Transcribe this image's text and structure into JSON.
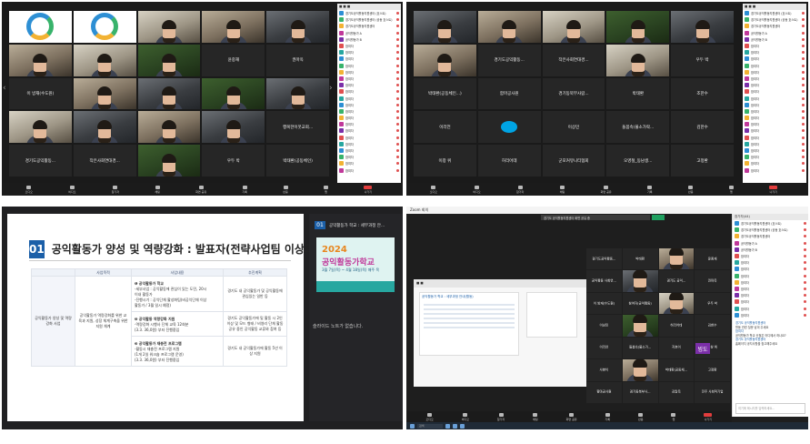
{
  "q1": {
    "tiles": [
      {
        "kind": "logo",
        "name": ""
      },
      {
        "kind": "logo",
        "name": ""
      },
      {
        "kind": "cam",
        "style": "office",
        "name": ""
      },
      {
        "kind": "cam",
        "style": "warm",
        "name": ""
      },
      {
        "kind": "cam",
        "style": "",
        "name": ""
      },
      {
        "kind": "cam",
        "style": "warm",
        "name": ""
      },
      {
        "kind": "cam",
        "style": "office",
        "name": ""
      },
      {
        "kind": "cam",
        "style": "green",
        "name": ""
      },
      {
        "kind": "text",
        "name": "윤중재"
      },
      {
        "kind": "text",
        "name": "권마옥"
      },
      {
        "kind": "text",
        "name": "이 방재(수도원)"
      },
      {
        "kind": "cam",
        "style": "warm",
        "name": ""
      },
      {
        "kind": "cam",
        "style": "",
        "name": ""
      },
      {
        "kind": "cam",
        "style": "green",
        "name": ""
      },
      {
        "kind": "cam",
        "style": "",
        "name": ""
      },
      {
        "kind": "cam",
        "style": "office",
        "name": ""
      },
      {
        "kind": "cam",
        "style": "",
        "name": ""
      },
      {
        "kind": "cam",
        "style": "warm",
        "name": ""
      },
      {
        "kind": "cam",
        "style": "",
        "name": ""
      },
      {
        "kind": "text",
        "name": "행복한이웃교회..."
      },
      {
        "kind": "text",
        "name": "경기도공익활동..."
      },
      {
        "kind": "text",
        "name": "작은사회연대경..."
      },
      {
        "kind": "cam",
        "style": "green",
        "name": ""
      },
      {
        "kind": "text",
        "name": "우두 박"
      },
      {
        "kind": "text",
        "name": "박태환(공동체인)"
      }
    ],
    "participants": [
      "경기도공익활동지원센터 (호스트)",
      "경기도공익활동지원센터 (공동 호스트)",
      "경기도공익활동지원센터",
      "공익활동가 A",
      "공익활동가 B",
      "참여자",
      "참여자",
      "참여자",
      "참여자",
      "참여자",
      "참여자",
      "참여자",
      "참여자",
      "참여자",
      "참여자",
      "참여자",
      "참여자",
      "참여자",
      "참여자",
      "참여자",
      "참여자",
      "참여자",
      "참여자",
      "참여자",
      "참여자"
    ]
  },
  "q2": {
    "tiles": [
      {
        "kind": "cam",
        "style": "",
        "name": ""
      },
      {
        "kind": "cam",
        "style": "warm",
        "name": ""
      },
      {
        "kind": "cam",
        "style": "office",
        "name": ""
      },
      {
        "kind": "cam",
        "style": "green",
        "name": ""
      },
      {
        "kind": "cam",
        "style": "",
        "name": ""
      },
      {
        "kind": "cam",
        "style": "warm",
        "name": ""
      },
      {
        "kind": "text",
        "name": "경기도공익활동..."
      },
      {
        "kind": "text",
        "name": "작은사회연대경..."
      },
      {
        "kind": "cam",
        "style": "office",
        "name": ""
      },
      {
        "kind": "text",
        "name": "우두 박"
      },
      {
        "kind": "text",
        "name": "박태환(공동체인...)"
      },
      {
        "kind": "text",
        "name": "함마공사원"
      },
      {
        "kind": "text",
        "name": "경기동북부사람..."
      },
      {
        "kind": "text",
        "name": "박태환"
      },
      {
        "kind": "text",
        "name": "조한수"
      },
      {
        "kind": "text",
        "name": "이리언"
      },
      {
        "kind": "pill",
        "name": ""
      },
      {
        "kind": "text",
        "name": "이상민"
      },
      {
        "kind": "text",
        "name": "돌봄속(불소가락..."
      },
      {
        "kind": "text",
        "name": "김한수"
      },
      {
        "kind": "text",
        "name": "이창 위"
      },
      {
        "kind": "text",
        "name": "허리어데"
      },
      {
        "kind": "text",
        "name": "군포커뮤니티협회"
      },
      {
        "kind": "text",
        "name": "오영철_동남생..."
      },
      {
        "kind": "text",
        "name": "고정환"
      }
    ]
  },
  "q3": {
    "slide_number": "01",
    "slide_title": "공익활동가 양성 및 역량강화 : 발표자(전략사업팀 이상화 팀장)",
    "table_headers": [
      "",
      "사업목적",
      "사업내용",
      "추진계획"
    ],
    "category": "공익활동가 양성 및 역량강화 사업",
    "goal": "공익활동가 역량강화를 위한 교육과 지원, 성장 체계구축을 위한 지원 체계",
    "rows": [
      {
        "title": "❶ 공익활동가 학교",
        "lines": [
          "-세부사업 : 공익활동에 관심이 있는 도민, 20시",
          "이내 활동가",
          "-진행시기 : 공익단체 활성화팀(비공익단체 이상",
          "활동가 / 3월 일시 예정)"
        ],
        "note": "경기도 내 공익활동가 및 공익활동에 관심있는 일반 등"
      },
      {
        "title": "❷ 공익활동 역량강화 지원",
        "lines": [
          "-역량강화 시행사 단체 교육 12회분",
          "(3.3. 36,0원) 부터 진행중임"
        ],
        "note": "경기도 공익활동가에 및 활동 시 2인 이상 및 모드 형태 / 비영리 단체 활동 공유 중인 공익활동 교류와 참여 등"
      },
      {
        "title": "❸ 공익활동가 재충전 프로그램",
        "lines": [
          "-활동시 재충전 프로그램 지원",
          "(1개 2일 워크숍 프로그램 운영)",
          "(3.3. 36,0원) 부터 진행중임"
        ],
        "note": "경기도 내 공익활동가에 활동 5년 이상 지원"
      }
    ],
    "side_number": "01",
    "side_title": "공익활동가 학교 : 세부과정 안...",
    "poster_year": "2024",
    "poster_title": "공익활동가학교",
    "poster_dates": "3월 7일(목) ~ 4월 18일(목) 매주 목",
    "notice": "슬라이드 노트가 없습니다."
  },
  "q4": {
    "window_title": "Zoom 회의",
    "share_banner": "경기도 공익활동지원센터 화면 공유 중",
    "shared_header": "공익활동가 학교 : 세부과정 안내(활동)",
    "tiles": [
      {
        "kind": "text",
        "name": "경기도공익활동..."
      },
      {
        "kind": "text",
        "name": "박태환"
      },
      {
        "kind": "cam",
        "style": "warm",
        "name": ""
      },
      {
        "kind": "text",
        "name": "윤중재"
      },
      {
        "kind": "text",
        "name": "공익활동 사회연..."
      },
      {
        "kind": "cam",
        "style": "",
        "name": ""
      },
      {
        "kind": "text",
        "name": "경기도 공익..."
      },
      {
        "kind": "text",
        "name": "권마옥"
      },
      {
        "kind": "text",
        "name": "이 방재(수도원)"
      },
      {
        "kind": "text",
        "name": "참여자(공익활동)"
      },
      {
        "kind": "cam",
        "style": "office",
        "name": ""
      },
      {
        "kind": "text",
        "name": "우두 박"
      },
      {
        "kind": "text",
        "name": "이상민"
      },
      {
        "kind": "cam",
        "style": "green",
        "name": ""
      },
      {
        "kind": "text",
        "name": "허리어데"
      },
      {
        "kind": "text",
        "name": "김한수"
      },
      {
        "kind": "text",
        "name": "이리언"
      },
      {
        "kind": "text",
        "name": "돌봄속(불소가..."
      },
      {
        "kind": "text",
        "name": "지호이"
      },
      {
        "kind": "text",
        "name": "이창 위"
      },
      {
        "kind": "text",
        "name": "사향이"
      },
      {
        "kind": "cam",
        "style": "warm",
        "name": ""
      },
      {
        "kind": "text",
        "name": "박태환(공동체..."
      },
      {
        "kind": "text",
        "name": "고정환"
      },
      {
        "kind": "text",
        "name": "함마공사원"
      },
      {
        "kind": "text",
        "name": "경기동북부사..."
      },
      {
        "kind": "text",
        "name": "김말옥"
      },
      {
        "kind": "text",
        "name": "전주 사회적기업"
      }
    ],
    "vd_label": "빙도",
    "chat_title": "참가자(44)",
    "chat_messages": [
      {
        "who": "경기도 공익활동지원센터",
        "text": "활동 관련 질문 남겨 주세요"
      },
      {
        "who": "참여자",
        "text": "공익활동가 학교 신청은 어디에서 하나요?"
      },
      {
        "who": "경기도 공익활동지원센터",
        "text": "홈페이지 공지사항을 참고해주세요"
      }
    ],
    "chat_placeholder": "여기에 메시지를 입력하세요...",
    "search_label": "검색"
  },
  "toolbar": [
    "오디오",
    "비디오",
    "참가자",
    "채팅",
    "화면 공유",
    "기록",
    "반응",
    "앱",
    "나가기"
  ],
  "colors": {
    "brand_blue": "#1b5fa8",
    "end_red": "#e23d3d",
    "zoom_bg": "#1a1a1a"
  }
}
